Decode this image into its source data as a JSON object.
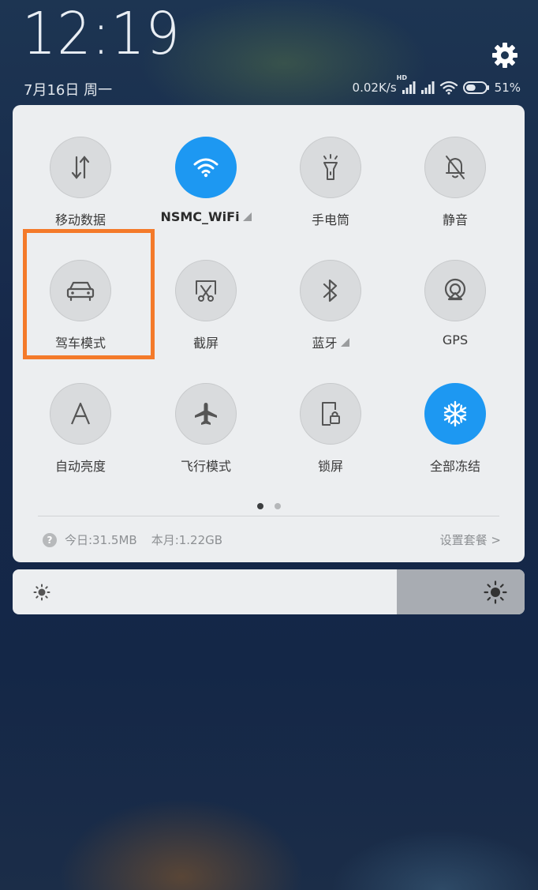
{
  "status": {
    "time": "12:19",
    "date": "7月16日 周一",
    "network_speed": "0.02K/s",
    "hd_label": "HD",
    "battery": "51%",
    "battery_level": 0.51
  },
  "tiles": [
    {
      "label": "移动数据"
    },
    {
      "label": "NSMC_WiFi"
    },
    {
      "label": "手电筒"
    },
    {
      "label": "静音"
    },
    {
      "label": "驾车模式"
    },
    {
      "label": "截屏"
    },
    {
      "label": "蓝牙"
    },
    {
      "label": "GPS"
    },
    {
      "label": "自动亮度"
    },
    {
      "label": "飞行模式"
    },
    {
      "label": "锁屏"
    },
    {
      "label": "全部冻结"
    }
  ],
  "data_usage": {
    "help": "?",
    "today": "今日:31.5MB",
    "month": "本月:1.22GB",
    "plan": "设置套餐 >"
  },
  "brightness": {
    "level": 0.75
  },
  "colors": {
    "active": "#1d98f2",
    "highlight": "#f47a2a"
  }
}
